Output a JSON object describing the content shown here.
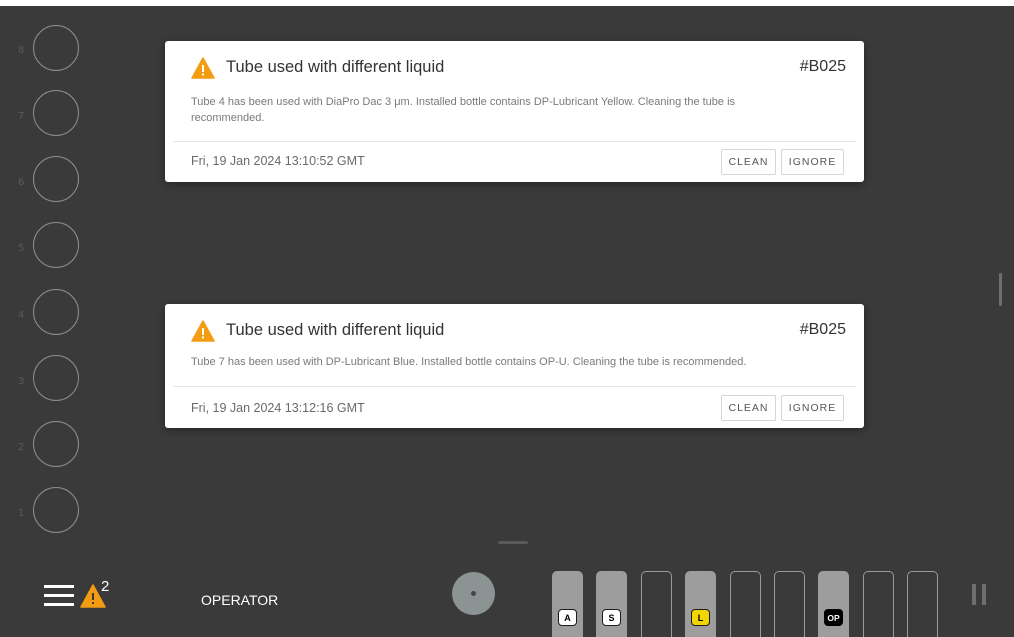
{
  "tubes": [
    {
      "number": "8"
    },
    {
      "number": "7"
    },
    {
      "number": "6"
    },
    {
      "number": "5"
    },
    {
      "number": "4"
    },
    {
      "number": "3"
    },
    {
      "number": "2"
    },
    {
      "number": "1"
    }
  ],
  "notifications": [
    {
      "title": "Tube used with different liquid",
      "code": "#B025",
      "message": "Tube 4 has been used with DiaPro Dac 3 μm. Installed bottle contains DP-Lubricant Yellow. Cleaning the tube is recommended.",
      "timestamp": "Fri, 19 Jan 2024 13:10:52 GMT",
      "clean_label": "CLEAN",
      "ignore_label": "IGNORE"
    },
    {
      "title": "Tube used with different liquid",
      "code": "#B025",
      "message": "Tube 7 has been used with DP-Lubricant Blue. Installed bottle contains OP-U. Cleaning the tube is recommended.",
      "timestamp": "Fri, 19 Jan 2024 13:12:16 GMT",
      "clean_label": "CLEAN",
      "ignore_label": "IGNORE"
    }
  ],
  "bottom_bar": {
    "alert_count": "2",
    "user_role": "OPERATOR",
    "bottle_slots": [
      {
        "label": "A",
        "filled": true,
        "chip_color": "#ffffff"
      },
      {
        "label": "S",
        "filled": true,
        "chip_color": "#ffffff"
      },
      {
        "label": "",
        "filled": false
      },
      {
        "label": "L",
        "filled": true,
        "chip_color": "#f2d600"
      },
      {
        "label": "",
        "filled": false
      },
      {
        "label": "",
        "filled": false
      },
      {
        "label": "OP",
        "filled": true,
        "chip_color": "#000000"
      },
      {
        "label": "",
        "filled": false
      },
      {
        "label": "",
        "filled": false
      }
    ]
  },
  "colors": {
    "background": "#3a3a3a",
    "warning": "#f39c12",
    "card": "#ffffff"
  }
}
